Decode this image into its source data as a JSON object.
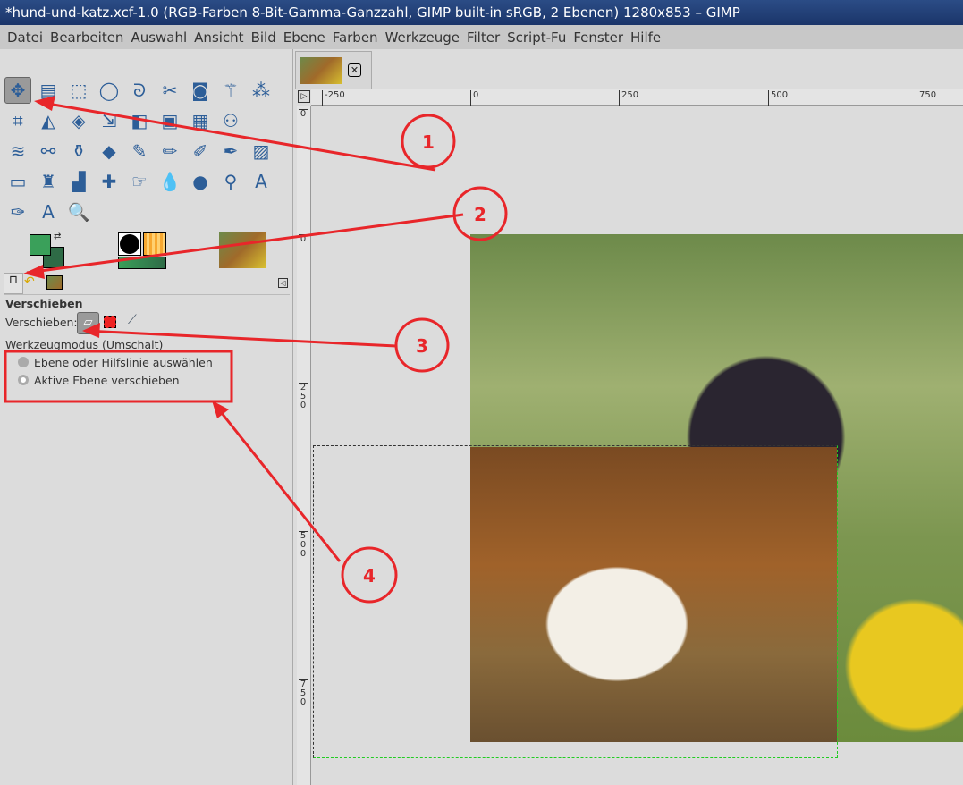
{
  "window": {
    "title": "*hund-und-katz.xcf-1.0 (RGB-Farben 8-Bit-Gamma-Ganzzahl, GIMP built-in sRGB, 2 Ebenen) 1280x853 – GIMP"
  },
  "menu": [
    "Datei",
    "Bearbeiten",
    "Auswahl",
    "Ansicht",
    "Bild",
    "Ebene",
    "Farben",
    "Werkzeuge",
    "Filter",
    "Script-Fu",
    "Fenster",
    "Hilfe"
  ],
  "tools": [
    [
      "✥",
      "▤",
      "⬚",
      "◯",
      "ᘐ",
      "✂",
      "◙",
      "⚚",
      "⁂"
    ],
    [
      "⌗",
      "◭",
      "◈",
      "⇲",
      "◧",
      "▣",
      "▦",
      "⚇",
      ""
    ],
    [
      "≋",
      "⚯",
      "⚱",
      "◆",
      "✎",
      "✏",
      "✐",
      "✒",
      "▨"
    ],
    [
      "▭",
      "♜",
      "▟",
      "✚",
      "☞",
      "💧",
      "●",
      "⚲",
      "A"
    ],
    [
      "✑",
      "A",
      "🔍"
    ]
  ],
  "tool_options": {
    "title": "Verschieben",
    "move_label": "Verschieben:",
    "mode_label": "Werkzeugmodus (Umschalt)",
    "options": [
      "Ebene oder Hilfslinie auswählen",
      "Aktive Ebene verschieben"
    ],
    "selected": 1
  },
  "rulers": {
    "top": [
      "-250",
      "0",
      "250",
      "500",
      "750"
    ],
    "left": [
      "0",
      "0",
      "250",
      "500",
      "750"
    ]
  },
  "annotations": [
    "1",
    "2",
    "3",
    "4"
  ],
  "colors": {
    "fg": "#3aa05a",
    "bg": "#2e6b46",
    "annotation": "#e8262a"
  }
}
